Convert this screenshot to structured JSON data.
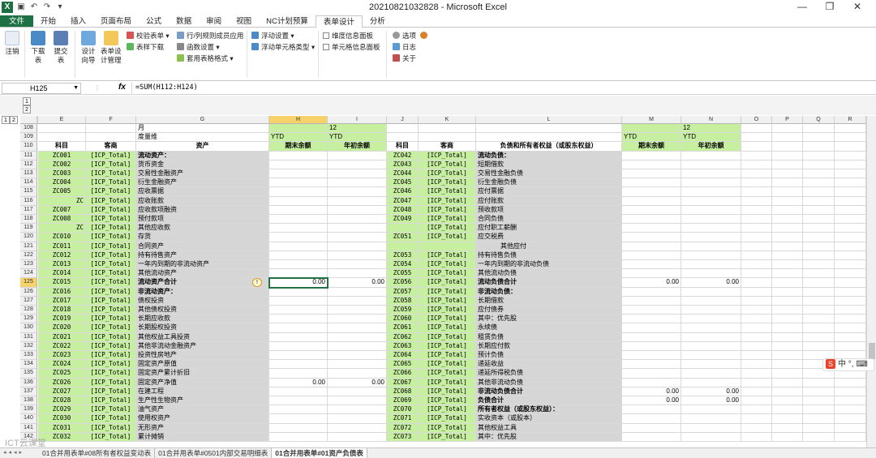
{
  "window": {
    "title": "20210821032828 - Microsoft Excel"
  },
  "ribbon_tabs": [
    "文件",
    "开始",
    "插入",
    "页面布局",
    "公式",
    "数据",
    "审阅",
    "视图",
    "NC计划预算",
    "表单设计",
    "分析"
  ],
  "active_tab": "表单设计",
  "ribbon": {
    "logout": "注销",
    "download": [
      "下载",
      "表"
    ],
    "submit": [
      "提交",
      "表"
    ],
    "design": [
      "设计",
      "向导"
    ],
    "form_design": [
      "表单设",
      "计管理"
    ],
    "small": [
      "校验表单",
      "表样下载",
      "行/列规则成员应用",
      "函数设置",
      "套用表格格式",
      "浮动设置",
      "浮动单元格类型",
      "维度信息面板",
      "单元格信息面板",
      "选项",
      "日志",
      "关于"
    ]
  },
  "formula_bar": {
    "cell": "H125",
    "fx": "fx",
    "formula": "=SUM(H112:H124)"
  },
  "outline_levels": [
    "1",
    "2"
  ],
  "columns": [
    "D",
    "E",
    "F",
    "G",
    "H",
    "I",
    "J",
    "K",
    "L",
    "M",
    "N",
    "O",
    "P",
    "Q",
    "R"
  ],
  "header_rows": [
    {
      "n": "108",
      "G": "月",
      "I": "12",
      "N": "12"
    },
    {
      "n": "109",
      "G": "度量维",
      "H": "YTD",
      "I": "YTD",
      "M": "YTD",
      "N": "YTD"
    },
    {
      "n": "110",
      "E": "科目",
      "F": "客商",
      "G": "资产",
      "H": "期末余额",
      "I": "年初余额",
      "J": "科目",
      "K": "客商",
      "L": "负债和所有者权益（或股东权益）",
      "M": "期末余额",
      "N": "年初余额"
    }
  ],
  "rows": [
    {
      "n": "111",
      "E": "ZC001",
      "F": "[ICP_Total]",
      "G": "流动资产：",
      "gb": true,
      "J": "ZC042",
      "K": "[ICP_Total]",
      "L": "流动负债：",
      "lb": true
    },
    {
      "n": "112",
      "E": "ZC002",
      "F": "[ICP_Total]",
      "G": "货币资金",
      "J": "ZC043",
      "K": "[ICP_Total]",
      "L": "短期借款"
    },
    {
      "n": "113",
      "E": "ZC003",
      "F": "[ICP_Total]",
      "G": "交易性金融资产",
      "J": "ZC044",
      "K": "[ICP_Total]",
      "L": "交易性金融负债"
    },
    {
      "n": "114",
      "E": "ZC004",
      "F": "[ICP_Total]",
      "G": "衍生金融资产",
      "J": "ZC045",
      "K": "[ICP_Total]",
      "L": "衍生金融负债"
    },
    {
      "n": "115",
      "E": "ZC005",
      "F": "[ICP_Total]",
      "G": "应收票据",
      "J": "ZC046",
      "K": "[ICP_Total]",
      "L": "应付票据"
    },
    {
      "n": "116",
      "E": "ZC",
      "Er": true,
      "F": "[ICP_Total]",
      "G": "应收账款",
      "J": "ZC047",
      "K": "[ICP_Total]",
      "L": "应付账款"
    },
    {
      "n": "117",
      "E": "ZC007",
      "F": "[ICP_Total]",
      "G": "应收款项融资",
      "J": "ZC048",
      "K": "[ICP_Total]",
      "L": "预收款项"
    },
    {
      "n": "118",
      "E": "ZC008",
      "F": "[ICP_Total]",
      "G": "预付款项",
      "J": "ZC049",
      "K": "[ICP_Total]",
      "L": "合同负债"
    },
    {
      "n": "119",
      "E": "ZC",
      "Er": true,
      "F": "[ICP_Total]",
      "G": "其他应收款",
      "J": "",
      "K": "[ICP_Total]",
      "L": "应付职工薪酬"
    },
    {
      "n": "120",
      "E": "ZC010",
      "F": "[ICP_Total]",
      "G": "存货",
      "J": "ZC051",
      "K": "[ICP_Total]",
      "L": "应交税费"
    },
    {
      "n": "121",
      "E": "ZC011",
      "F": "[ICP_Total]",
      "G": "合同资产",
      "J": "",
      "K": "",
      "L": "其他应付",
      "li": true
    },
    {
      "n": "122",
      "E": "ZC012",
      "F": "[ICP_Total]",
      "G": "持有待售资产",
      "J": "ZC053",
      "K": "[ICP_Total]",
      "L": "持有待售负债"
    },
    {
      "n": "123",
      "E": "ZC013",
      "F": "[ICP_Total]",
      "G": "一年内到期的非流动资产",
      "J": "ZC054",
      "K": "[ICP_Total]",
      "L": "一年内到期的非流动负债"
    },
    {
      "n": "124",
      "E": "ZC014",
      "F": "[ICP_Total]",
      "G": "其他流动资产",
      "J": "ZC055",
      "K": "[ICP_Total]",
      "L": "其他流动负债"
    },
    {
      "n": "125",
      "E": "ZC015",
      "F": "[ICP_Total]",
      "G": "流动资产合计",
      "gb": true,
      "H": "0.00",
      "I": "0.00",
      "J": "ZC056",
      "K": "[ICP_Total]",
      "L": "流动负债合计",
      "lb": true,
      "M": "0.00",
      "N": "0.00",
      "sel": true
    },
    {
      "n": "126",
      "E": "ZC016",
      "F": "[ICP_Total]",
      "G": "非流动资产：",
      "gb": true,
      "J": "ZC057",
      "K": "[ICP_Total]",
      "L": "非流动负债：",
      "lb": true
    },
    {
      "n": "127",
      "E": "ZC017",
      "F": "[ICP_Total]",
      "G": "债权投资",
      "J": "ZC058",
      "K": "[ICP_Total]",
      "L": "长期借款"
    },
    {
      "n": "128",
      "E": "ZC018",
      "F": "[ICP_Total]",
      "G": "其他债权投资",
      "J": "ZC059",
      "K": "[ICP_Total]",
      "L": "应付债券"
    },
    {
      "n": "129",
      "E": "ZC019",
      "F": "[ICP_Total]",
      "G": "长期应收款",
      "J": "ZC060",
      "K": "[ICP_Total]",
      "L": "其中：优先股"
    },
    {
      "n": "130",
      "E": "ZC020",
      "F": "[ICP_Total]",
      "G": "长期股权投资",
      "J": "ZC061",
      "K": "[ICP_Total]",
      "L": "永续债"
    },
    {
      "n": "131",
      "E": "ZC021",
      "F": "[ICP_Total]",
      "G": "其他权益工具投资",
      "J": "ZC062",
      "K": "[ICP_Total]",
      "L": "租赁负债"
    },
    {
      "n": "132",
      "E": "ZC022",
      "F": "[ICP_Total]",
      "G": "其他非流动金融资产",
      "J": "ZC063",
      "K": "[ICP_Total]",
      "L": "长期应付款"
    },
    {
      "n": "133",
      "E": "ZC023",
      "F": "[ICP_Total]",
      "G": "投资性房地产",
      "J": "ZC064",
      "K": "[ICP_Total]",
      "L": "预计负债"
    },
    {
      "n": "134",
      "E": "ZC024",
      "F": "[ICP_Total]",
      "G": "固定资产原值",
      "J": "ZC065",
      "K": "[ICP_Total]",
      "L": "递延收益"
    },
    {
      "n": "135",
      "E": "ZC025",
      "F": "[ICP_Total]",
      "G": "固定资产累计折旧",
      "J": "ZC066",
      "K": "[ICP_Total]",
      "L": "递延所得税负债"
    },
    {
      "n": "136",
      "E": "ZC026",
      "F": "[ICP_Total]",
      "G": "固定资产净值",
      "H": "0.00",
      "I": "0.00",
      "J": "ZC067",
      "K": "[ICP_Total]",
      "L": "其他非流动负债"
    },
    {
      "n": "137",
      "E": "ZC027",
      "F": "[ICP_Total]",
      "G": "在建工程",
      "J": "ZC068",
      "K": "[ICP_Total]",
      "L": "非流动负债合计",
      "lb": true,
      "M": "0.00",
      "N": "0.00"
    },
    {
      "n": "138",
      "E": "ZC028",
      "F": "[ICP_Total]",
      "G": "生产性生物资产",
      "J": "ZC069",
      "K": "[ICP_Total]",
      "L": "负债合计",
      "lb": true,
      "M": "0.00",
      "N": "0.00"
    },
    {
      "n": "139",
      "E": "ZC029",
      "F": "[ICP_Total]",
      "G": "油气资产",
      "J": "ZC070",
      "K": "[ICP_Total]",
      "L": "所有者权益（或股东权益）：",
      "lb": true
    },
    {
      "n": "140",
      "E": "ZC030",
      "F": "[ICP_Total]",
      "G": "使用权资产",
      "J": "ZC071",
      "K": "[ICP_Total]",
      "L": "实收资本（或股本）"
    },
    {
      "n": "141",
      "E": "ZC031",
      "F": "[ICP_Total]",
      "G": "无形资产",
      "J": "ZC072",
      "K": "[ICP_Total]",
      "L": "其他权益工具"
    },
    {
      "n": "142",
      "E": "ZC032",
      "F": "[ICP_Total]",
      "G": "累计摊销",
      "J": "ZC073",
      "K": "[ICP_Total]",
      "L": "其中：优先股"
    }
  ],
  "sheet_tabs": [
    "01合并用表单#08所有者权益变动表",
    "01合并用表单#0501内部交易明细表",
    "01合并用表单#01资产负债表"
  ],
  "ime": {
    "logo": "S",
    "text": "中"
  },
  "watermark": "ICT云课堂"
}
